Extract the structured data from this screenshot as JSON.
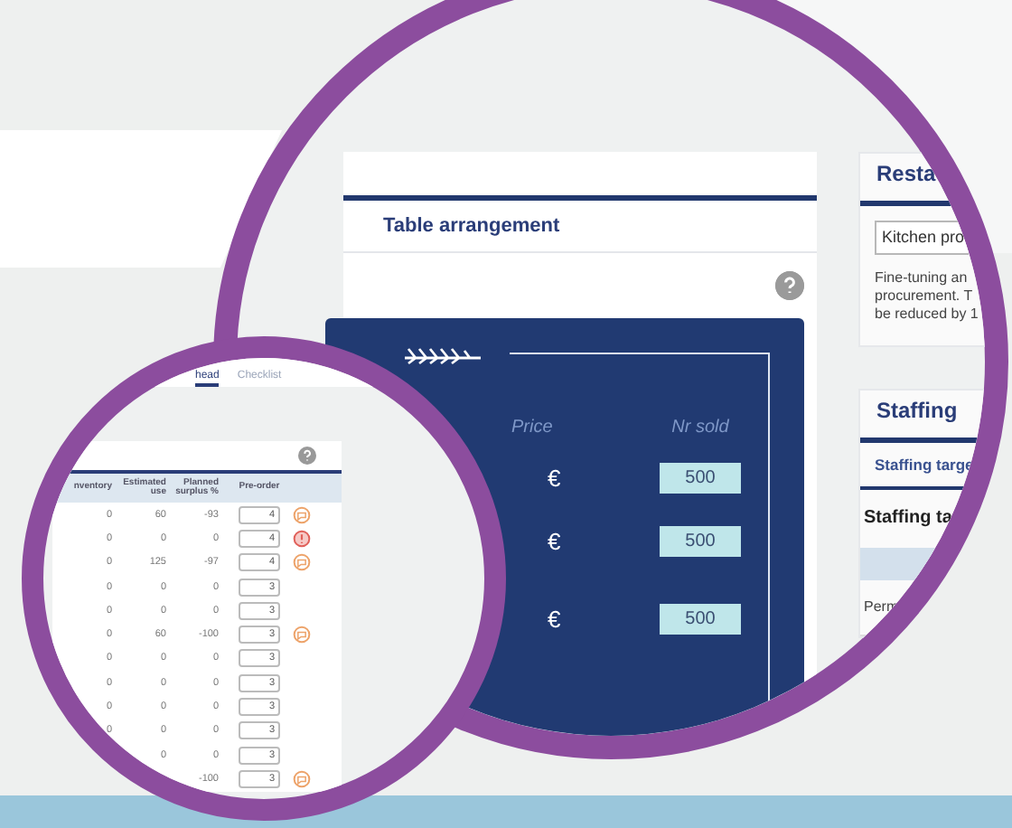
{
  "table_view": {
    "tabs": [
      {
        "label": "head",
        "selected": true
      },
      {
        "label": "Checklist",
        "selected": false
      }
    ],
    "columns": [
      "nventory",
      "Estimated use",
      "Planned surplus %",
      "Pre-order"
    ],
    "rows": [
      {
        "inventory": "0",
        "estimated_use": "60",
        "planned_surplus": "-93",
        "pre_order": "4",
        "kind": "note"
      },
      {
        "inventory": "0",
        "estimated_use": "0",
        "planned_surplus": "0",
        "pre_order": "4",
        "kind": "alert"
      },
      {
        "inventory": "0",
        "estimated_use": "125",
        "planned_surplus": "-97",
        "pre_order": "4",
        "kind": "note"
      },
      {
        "inventory": "0",
        "estimated_use": "0",
        "planned_surplus": "0",
        "pre_order": "3",
        "kind": "plain"
      },
      {
        "inventory": "0",
        "estimated_use": "0",
        "planned_surplus": "0",
        "pre_order": "3",
        "kind": "plain"
      },
      {
        "inventory": "0",
        "estimated_use": "60",
        "planned_surplus": "-100",
        "pre_order": "3",
        "kind": "note"
      },
      {
        "inventory": "0",
        "estimated_use": "0",
        "planned_surplus": "0",
        "pre_order": "3",
        "kind": "plain"
      },
      {
        "inventory": "0",
        "estimated_use": "0",
        "planned_surplus": "0",
        "pre_order": "3",
        "kind": "plain"
      },
      {
        "inventory": "0",
        "estimated_use": "0",
        "planned_surplus": "0",
        "pre_order": "3",
        "kind": "plain"
      },
      {
        "inventory": "0",
        "estimated_use": "0",
        "planned_surplus": "0",
        "pre_order": "3",
        "kind": "plain"
      },
      {
        "estimated_use": "0",
        "planned_surplus": "0",
        "pre_order": "3",
        "kind": "plain"
      },
      {
        "planned_surplus": "-100",
        "pre_order": "3",
        "kind": "note"
      }
    ]
  },
  "menu_view": {
    "section_title": "Table arrangement",
    "menu_card": {
      "columns": [
        "Price",
        "Nr sold"
      ],
      "rows": [
        {
          "currency": "€",
          "nr_sold": "500"
        },
        {
          "currency": "€",
          "nr_sold": "500"
        },
        {
          "currency": "€",
          "nr_sold": "500"
        }
      ]
    }
  },
  "side_panel": {
    "restaurant": {
      "title": "Resta",
      "dropdown": "Kitchen pro",
      "description_lines": [
        "Fine-tuning an",
        "procurement. T",
        "be reduced by 1"
      ]
    },
    "staffing": {
      "title": "Staffing",
      "tab": "Staffing targe",
      "heading": "Staffing ta",
      "row_label": "Perm"
    }
  }
}
